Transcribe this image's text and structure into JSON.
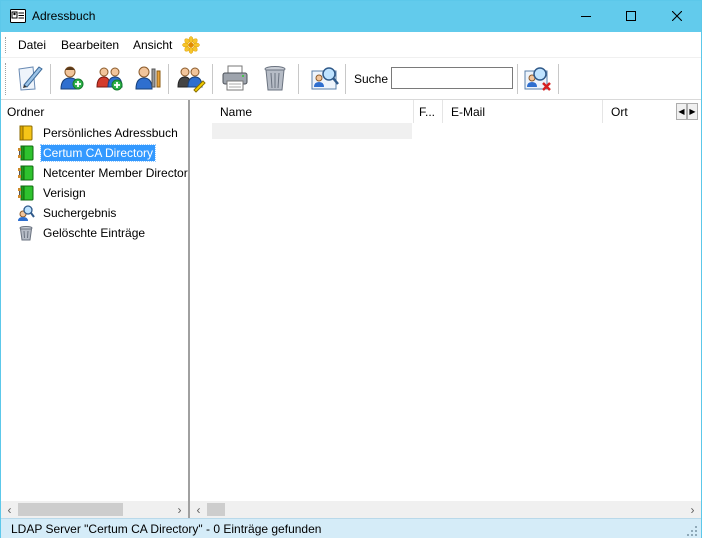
{
  "window": {
    "title": "Adressbuch",
    "controls": [
      "minimize-icon",
      "maximize-icon",
      "close-icon"
    ]
  },
  "menu": {
    "items": [
      "Datei",
      "Bearbeiten",
      "Ansicht"
    ],
    "extra_icon": "flower-icon"
  },
  "toolbar": {
    "buttons": [
      {
        "icon": "pen-paper-icon"
      },
      {
        "icon": "add-contact-icon"
      },
      {
        "icon": "add-group-icon"
      },
      {
        "icon": "contact-properties-icon"
      },
      {
        "icon": "edit-contact-icon"
      },
      {
        "icon": "printer-icon"
      },
      {
        "icon": "trash-icon"
      },
      {
        "icon": "search-contact-icon"
      },
      {
        "icon": "clear-search-icon"
      }
    ],
    "search_label": "Suche",
    "search_value": ""
  },
  "folders": {
    "header": "Ordner",
    "items": [
      {
        "label": "Persönliches Adressbuch",
        "icon": "yellow-book-icon",
        "selected": false
      },
      {
        "label": "Certum CA Directory",
        "icon": "ldap-directory-icon",
        "selected": true
      },
      {
        "label": "Netcenter Member Director",
        "icon": "ldap-directory-icon",
        "selected": false
      },
      {
        "label": "Verisign",
        "icon": "ldap-directory-icon",
        "selected": false
      },
      {
        "label": "Suchergebnis",
        "icon": "search-result-icon",
        "selected": false
      },
      {
        "label": "Gelöschte Einträge",
        "icon": "trash-icon",
        "selected": false
      }
    ]
  },
  "contacts_table": {
    "columns": [
      "Name",
      "F...",
      "E-Mail",
      "Ort"
    ],
    "rows": []
  },
  "status": {
    "text": "LDAP Server \"Certum CA Directory\" - 0 Einträge gefunden"
  },
  "colors": {
    "titlebar": "#62cbec",
    "selection": "#3399ff",
    "statusbar": "#d5ecf8"
  }
}
